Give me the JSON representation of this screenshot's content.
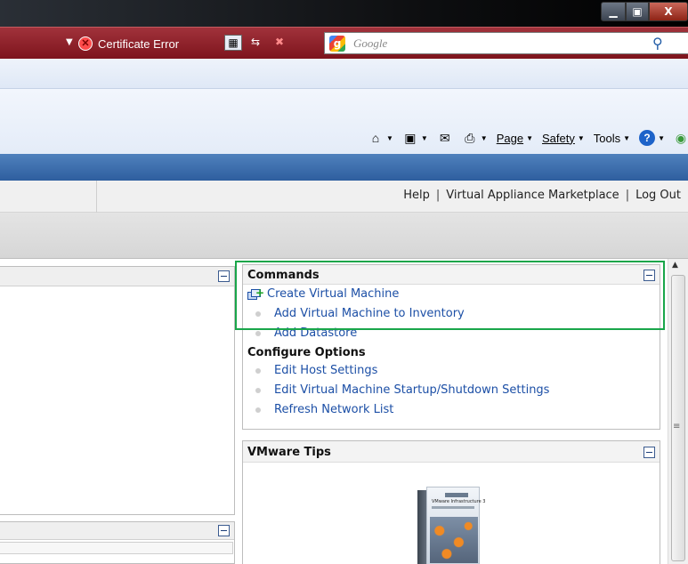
{
  "browser": {
    "window_controls": {
      "minimize": "▁",
      "maximize": "▣",
      "close": "X"
    },
    "address_bar": {
      "cert_error_label": "Certificate Error",
      "search_placeholder": "Google"
    },
    "command_bar": {
      "page_label": "Page",
      "safety_label": "Safety",
      "tools_label": "Tools",
      "help_label": "?"
    }
  },
  "app": {
    "top_links": [
      "Help",
      "Virtual Appliance Marketplace",
      "Log Out"
    ],
    "commands_panel": {
      "title": "Commands",
      "items": [
        "Create Virtual Machine",
        "Add Virtual Machine to Inventory",
        "Add Datastore"
      ],
      "configure_title": "Configure Options",
      "configure_items": [
        "Edit Host Settings",
        "Edit Virtual Machine Startup/Shutdown Settings",
        "Refresh Network List"
      ]
    },
    "tips_panel": {
      "title": "VMware Tips",
      "box_title": "VMware Infrastructure 3"
    }
  },
  "colors": {
    "link": "#1c4fa6",
    "highlight": "#19a64a",
    "addr_bar": "#8f1f28",
    "app_band": "#3c6eb0"
  }
}
